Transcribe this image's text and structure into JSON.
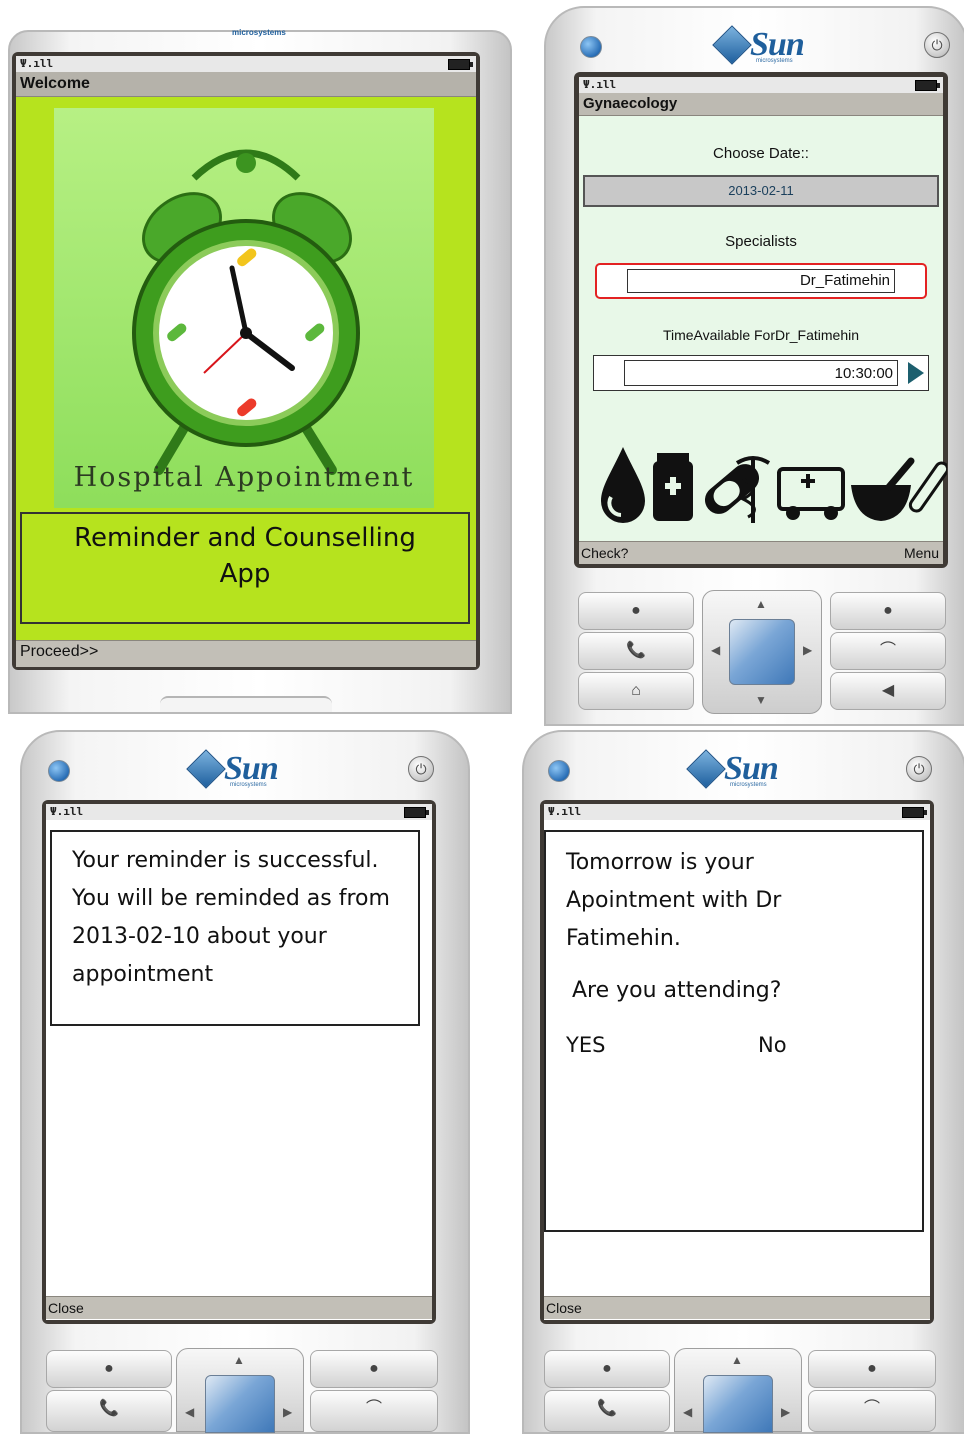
{
  "screen1": {
    "title": "Welcome",
    "art_caption": "Hospital Appointment",
    "box_line1": "Reminder and Counselling",
    "box_line2": "App",
    "soft_left": "Proceed>>",
    "brand_small": "microsystems"
  },
  "screen2": {
    "brand": "Sun",
    "brand_sub": "microsystems",
    "title": "Gynaecology",
    "choose_date_label": "Choose Date::",
    "date_value": "2013-02-11",
    "specialists_label": "Specialists",
    "specialist_value": "Dr_Fatimehin",
    "time_label": "TimeAvailable ForDr_Fatimehin",
    "time_value": "10:30:00",
    "soft_left": "Check?",
    "soft_right": "Menu"
  },
  "screen3": {
    "brand": "Sun",
    "brand_sub": "microsystems",
    "message": "Your reminder is successful. You will be reminded as from 2013-02-10 about your appointment",
    "soft_left": "Close"
  },
  "screen4": {
    "brand": "Sun",
    "brand_sub": "microsystems",
    "line1": "Tomorrow is your",
    "line2": "Apointment with Dr",
    "line3": "Fatimehin.",
    "question": "Are you attending?",
    "yes_label": "YES",
    "no_label": "No",
    "soft_left": "Close"
  },
  "colors": {
    "title_bar": "#bdbab2",
    "screen1_green": "#b6e31e",
    "screen2_bg": "#e8f8e8",
    "focus_red": "#e32222"
  }
}
